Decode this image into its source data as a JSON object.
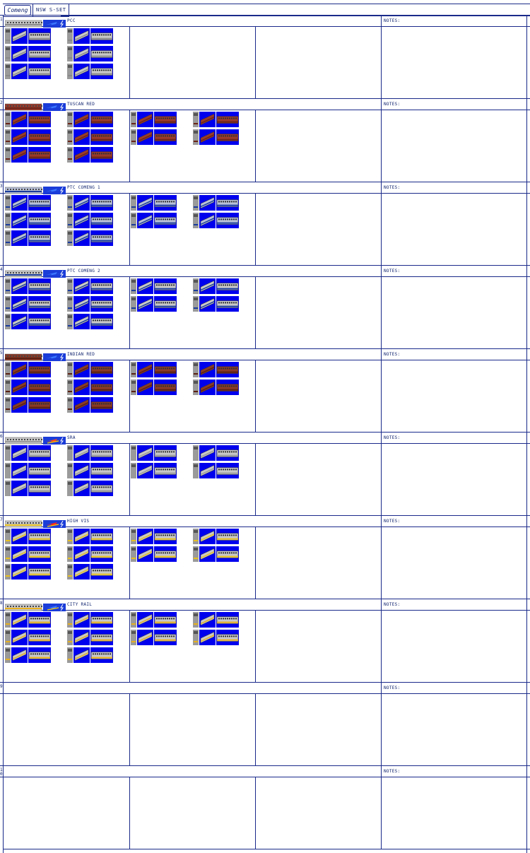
{
  "header": {
    "logo_text": "Comeng",
    "set_title": "NSW S-SET"
  },
  "notes_label": "NOTES:",
  "colors": {
    "line": "#1a2a8a",
    "sprite_bg": "#0000ee",
    "car_grey": "#c8c8c8",
    "car_dark": "#7a7a7a"
  },
  "sections": [
    {
      "number": "1",
      "name": "PCC",
      "livery": "pcc",
      "has_graphics": true,
      "groups": 2
    },
    {
      "number": "2",
      "name": "TUSCAN RED",
      "livery": "tuscan",
      "has_graphics": true,
      "groups": 4
    },
    {
      "number": "3",
      "name": "PTC COMENG 1",
      "livery": "ptc1",
      "has_graphics": true,
      "groups": 4
    },
    {
      "number": "4",
      "name": "PTC COMENG 2",
      "livery": "ptc2",
      "has_graphics": true,
      "groups": 4
    },
    {
      "number": "5",
      "name": "INDIAN RED",
      "livery": "indian",
      "has_graphics": true,
      "groups": 4
    },
    {
      "number": "6",
      "name": "SRA",
      "livery": "sra",
      "has_graphics": true,
      "groups": 4
    },
    {
      "number": "7",
      "name": "HIGH VIS",
      "livery": "highvis",
      "has_graphics": true,
      "groups": 4
    },
    {
      "number": "8",
      "name": "CITY RAIL",
      "livery": "cityrail",
      "has_graphics": true,
      "groups": 4
    },
    {
      "number": "9",
      "name": "",
      "livery": "none",
      "has_graphics": false,
      "groups": 0
    },
    {
      "number": "1\n0",
      "name": "",
      "livery": "none",
      "has_graphics": false,
      "groups": 0
    }
  ]
}
